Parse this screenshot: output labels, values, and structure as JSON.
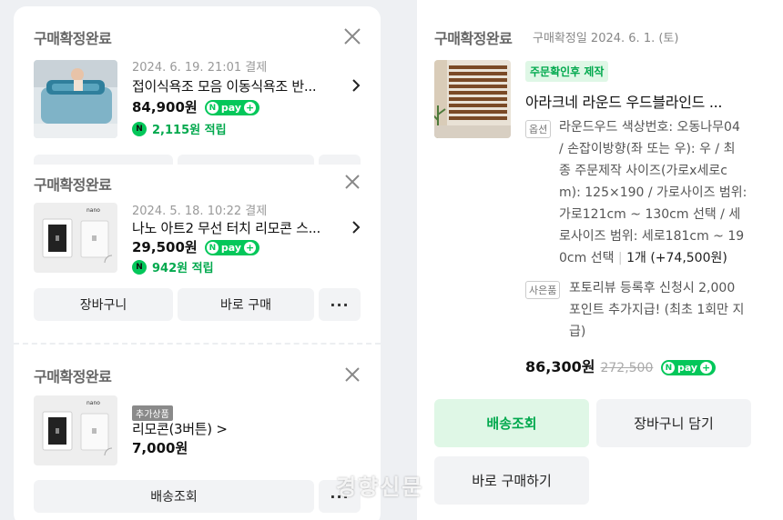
{
  "left": {
    "cards": [
      {
        "status": "구매확정완료",
        "date": "2024. 6. 19. 21:01 결제",
        "name": "접이식욕조 모음 이동식욕조 반...",
        "price": "84,900원",
        "points": "2,115원 적립"
      },
      {
        "status": "구매확정완료",
        "date": "2024. 5. 18. 10:22 결제",
        "name": "나노 아트2 무선 터치 리모콘 스...",
        "price": "29,500원",
        "points": "942원 적립",
        "buttons": [
          "장바구니",
          "바로 구매"
        ]
      },
      {
        "status": "구매확정완료",
        "addon_badge": "추가상품",
        "name": "리모콘(3버튼) >",
        "price": "7,000원",
        "buttons": [
          "배송조회"
        ]
      }
    ],
    "npay_label": "pay",
    "more_label": "···",
    "brand_mark": "nano"
  },
  "right": {
    "status": "구매확정완료",
    "confirm_date": "구매확정일 2024. 6. 1. (토)",
    "tag": "주문확인후 제작",
    "name": "아라크네 라운드 우드블라인드 ...",
    "option_badge": "옵션",
    "option_lines": [
      "라운드우드 색상번호: 오동나무04",
      "/ 손잡이방향(좌 또는 우): 우 / 최",
      "종 주문제작 사이즈(가로x세로c",
      "m): 125×190 / 가로사이즈 범위:",
      "가로121cm ~ 130cm 선택 / 세",
      "로사이즈 범위: 세로181cm ~ 19",
      "0cm 선택"
    ],
    "option_qty": "1개 (+74,500원)",
    "gift_badge": "사은품",
    "gift_lines": [
      "포토리뷰 등록후 신청시 2,000",
      "포인트 추가지급! (최초 1회만 지",
      "급)"
    ],
    "price": "86,300원",
    "original_price": "272,500",
    "buttons": {
      "track": "배송조회",
      "cart": "장바구니 담기",
      "buy": "바로 구매하기"
    }
  },
  "watermark": "경향신문",
  "colors": {
    "npay_green": "#03c75a",
    "accent_green_text": "#02a94e",
    "accent_green_bg": "#dff7e6",
    "background": "#eef0f3"
  }
}
